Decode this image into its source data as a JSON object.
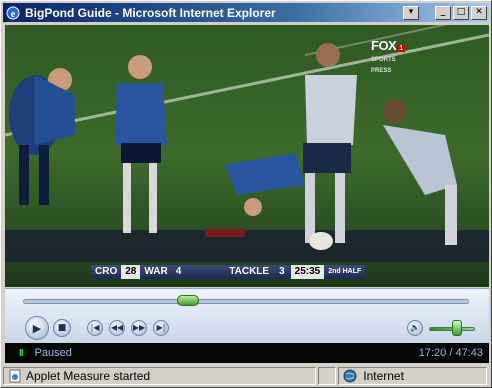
{
  "window": {
    "title": "BigPond Guide - Microsoft Internet Explorer",
    "buttons": {
      "menu": "▾",
      "minimize": "_",
      "maximize": "□",
      "close": "✕"
    }
  },
  "video": {
    "broadcaster": {
      "logo_main": "FOX",
      "logo_badge": "1",
      "logo_sub": "SPORTS",
      "logo_sub2": "PRESS"
    },
    "scorebar": {
      "team1": "CRO",
      "score1": "28",
      "team2": "WAR",
      "score2": "4",
      "event": "TACKLE",
      "tackle_count": "3",
      "clock": "25:35",
      "period": "2nd HALF"
    }
  },
  "player": {
    "seek_progress": 0.37,
    "volume_level": 0.6,
    "buttons": {
      "play": "▶",
      "stop": "■",
      "previous": "|◀",
      "rewind": "◀◀",
      "fast_forward": "▶▶",
      "next": "▶|",
      "mute": "🔈"
    },
    "state": "Paused",
    "time": "17:20 / 47:43",
    "state_glyph": "II"
  },
  "statusbar": {
    "message": "Applet Measure started",
    "zone": "Internet"
  },
  "colors": {
    "titlebar_start": "#0a246a",
    "titlebar_end": "#a6caf0",
    "seek_thumb": "#3a9e2a",
    "status_text": "#9ab7e6",
    "pause_glyph": "#33cc33"
  }
}
